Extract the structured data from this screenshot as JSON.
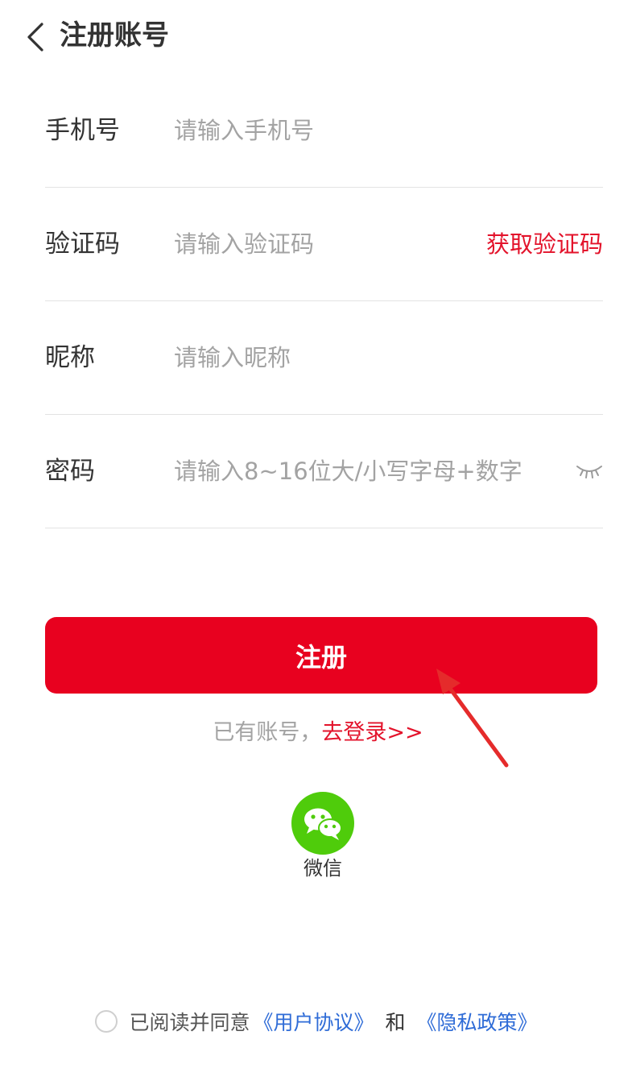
{
  "header": {
    "title": "注册账号",
    "back_icon": "chevron-left-icon"
  },
  "form": {
    "phone": {
      "label": "手机号",
      "placeholder": "请输入手机号",
      "value": ""
    },
    "code": {
      "label": "验证码",
      "placeholder": "请输入验证码",
      "value": "",
      "action": "获取验证码"
    },
    "nickname": {
      "label": "昵称",
      "placeholder": "请输入昵称",
      "value": ""
    },
    "password": {
      "label": "密码",
      "placeholder": "请输入8~16位大/小写字母+数字",
      "value": "",
      "toggle_icon": "eye-closed-icon"
    }
  },
  "register_button": {
    "label": "注册"
  },
  "login_prompt": {
    "text": "已有账号，",
    "link": "去登录>>"
  },
  "social": {
    "wechat_label": "微信",
    "wechat_icon": "wechat-icon"
  },
  "agreement": {
    "text": "已阅读并同意",
    "user_agreement": "《用户协议》",
    "and": "和",
    "privacy_policy": "《隐私政策》",
    "checked": false
  },
  "colors": {
    "primary": "#e8011f",
    "link_red": "#e3132b",
    "link_blue": "#2f6cd7",
    "wechat_green": "#4fcc0b",
    "text": "#333333",
    "placeholder": "#a3a3a3"
  }
}
